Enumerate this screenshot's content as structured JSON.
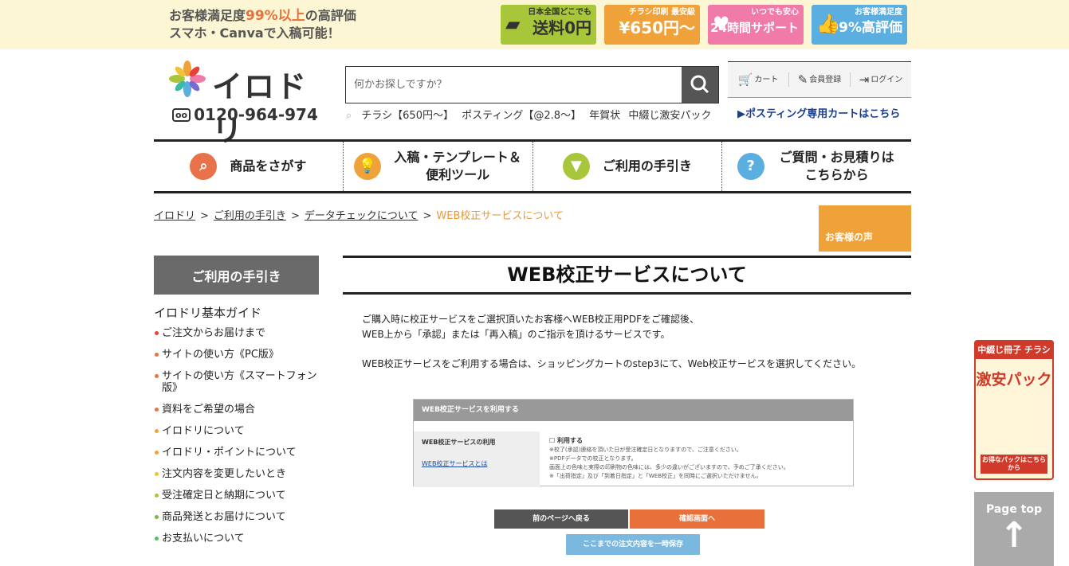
{
  "promo": {
    "line1_a": "お客様満足度",
    "line1_b": "99%以上",
    "line1_c": "の高評価",
    "line2": "スマホ・Canvaで入稿可能！"
  },
  "badges": [
    {
      "l1": "日本全国どこでも",
      "l2": "送料0円"
    },
    {
      "l1": "チラシ印刷 最安級",
      "l2": "¥650円〜"
    },
    {
      "l1": "いつでも安心",
      "l2": "24時間サポート"
    },
    {
      "l1": "お客様満足度",
      "l2": "99%高評価"
    }
  ],
  "logo": {
    "name": "イロドリ",
    "free_dial": "oo",
    "tel": "0120-964-974"
  },
  "search": {
    "placeholder": "何かお探しですか？",
    "tags": [
      "チラシ【650円〜】",
      "ポスティング【@2.8〜】",
      "年賀状",
      "中綴じ激安パック"
    ]
  },
  "user_nav": {
    "cart": "カート",
    "register": "会員登録",
    "login": "ログイン"
  },
  "posting_cart": "▶ポスティング専用カートはこちら",
  "global_nav": [
    {
      "label": "商品をさがす",
      "icon": "search-icon",
      "color": "#e8734a"
    },
    {
      "label": "入稿・テンプレート＆便利ツール",
      "icon": "lightbulb-icon",
      "color": "#f0a23a"
    },
    {
      "label": "ご利用の手引き",
      "icon": "beginner-mark-icon",
      "color": "#a8c63a"
    },
    {
      "label": "ご質問・お見積りはこちらから",
      "icon": "question-icon",
      "color": "#5aaee0"
    }
  ],
  "breadcrumb": {
    "items": [
      "イロドリ",
      "ご利用の手引き",
      "データチェックについて"
    ],
    "current": "WEB校正サービスについて"
  },
  "voice": "お客様の声",
  "sidebar": {
    "header": "ご利用の手引き",
    "group_title": "イロドリ基本ガイド",
    "items": [
      {
        "label": "ご注文からお届けまで",
        "color": "#e8403a"
      },
      {
        "label": "サイトの使い方《PC版》",
        "color": "#e8734a"
      },
      {
        "label": "サイトの使い方《スマートフォン版》",
        "color": "#e8734a"
      },
      {
        "label": "資料をご希望の場合",
        "color": "#e8734a"
      },
      {
        "label": "イロドリについて",
        "color": "#f0a23a"
      },
      {
        "label": "イロドリ・ポイントについて",
        "color": "#f0a23a"
      },
      {
        "label": "注文内容を変更したいとき",
        "color": "#f0c23a"
      },
      {
        "label": "受注確定日と納期について",
        "color": "#a8c63a"
      },
      {
        "label": "商品発送とお届けについて",
        "color": "#7ab840"
      },
      {
        "label": "お支払いについて",
        "color": "#5ab860"
      }
    ]
  },
  "main": {
    "title": "WEB校正サービスについて",
    "p1_l1": "ご購入時に校正サービスをご選択頂いたお客様へWEB校正用PDFをご確認後、",
    "p1_l2": "WEB上から「承認」または「再入稿」のご指示を頂けるサービスです。",
    "p2": "WEB校正サービスをご利用する場合は、ショッピングカートのstep3にて、Web校正サービスを選択してください。",
    "shot": {
      "header": "WEB校正サービスを利用する",
      "left_label": "WEB校正サービスの利用",
      "left_link": "WEB校正サービスとは",
      "checkbox": "利用する",
      "n1": "※校了(承認)連絡を頂いた日が受注確定日となりますので、ご注意ください。",
      "n2": "※PDFデータでの校正となります。",
      "n3": "画面上の色味と実際の印刷物の色味には、多少の違いがございますので、予めご了承ください。",
      "n4": "※「出荷指定」及び「到着日指定」と「WEB校正」を同時にご選択いただけません。"
    },
    "btn_back": "前のページへ戻る",
    "btn_confirm": "確認画面へ",
    "btn_save": "ここまでの注文内容を一時保存"
  },
  "gekiyasu": {
    "top": "中綴じ冊子 チラシ",
    "big": "激安パック",
    "foot": "お得なパックはこちらから"
  },
  "page_top": "Page top"
}
